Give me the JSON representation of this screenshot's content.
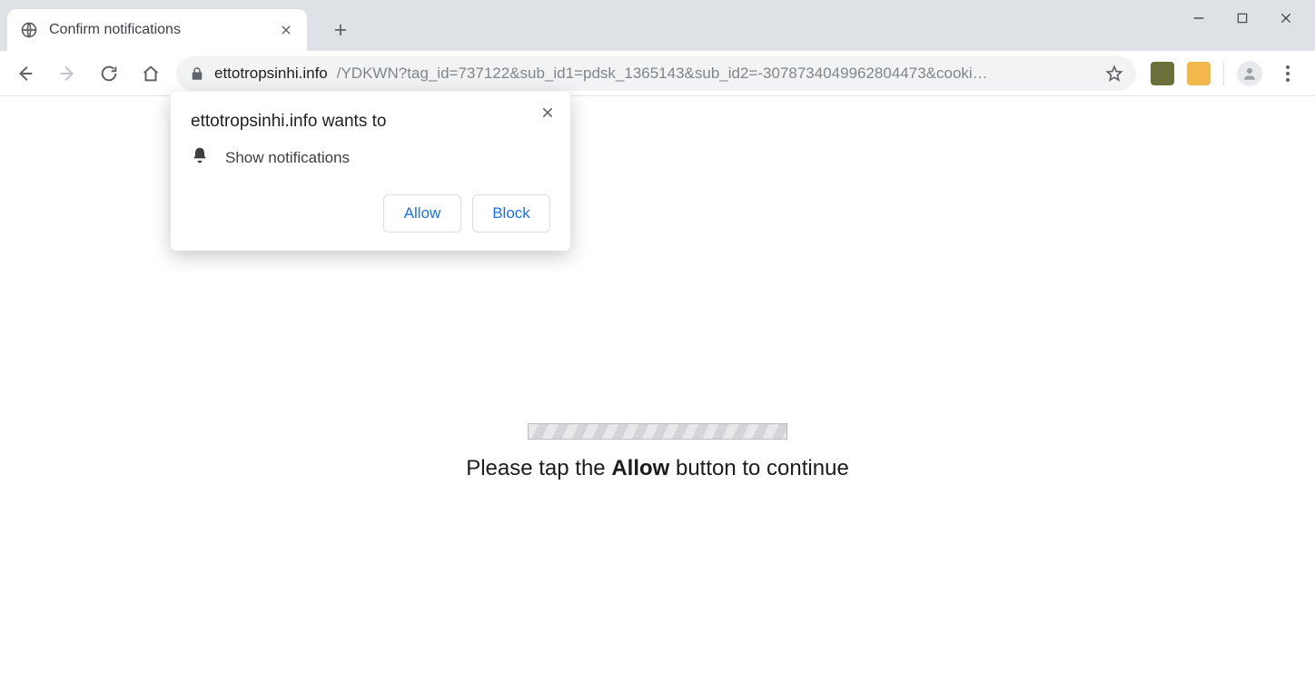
{
  "tab": {
    "title": "Confirm notifications"
  },
  "url": {
    "domain": "ettotropsinhi.info",
    "path": "/YDKWN?tag_id=737122&sub_id1=pdsk_1365143&sub_id2=-3078734049962804473&cooki…"
  },
  "permission": {
    "title": "ettotropsinhi.info wants to",
    "item": "Show notifications",
    "allow": "Allow",
    "block": "Block"
  },
  "page": {
    "msg_before": "Please tap the ",
    "msg_bold": "Allow",
    "msg_after": " button to continue"
  },
  "extensions": {
    "ext1_color": "#6b6f3a",
    "ext2_color": "#f2b84b"
  }
}
